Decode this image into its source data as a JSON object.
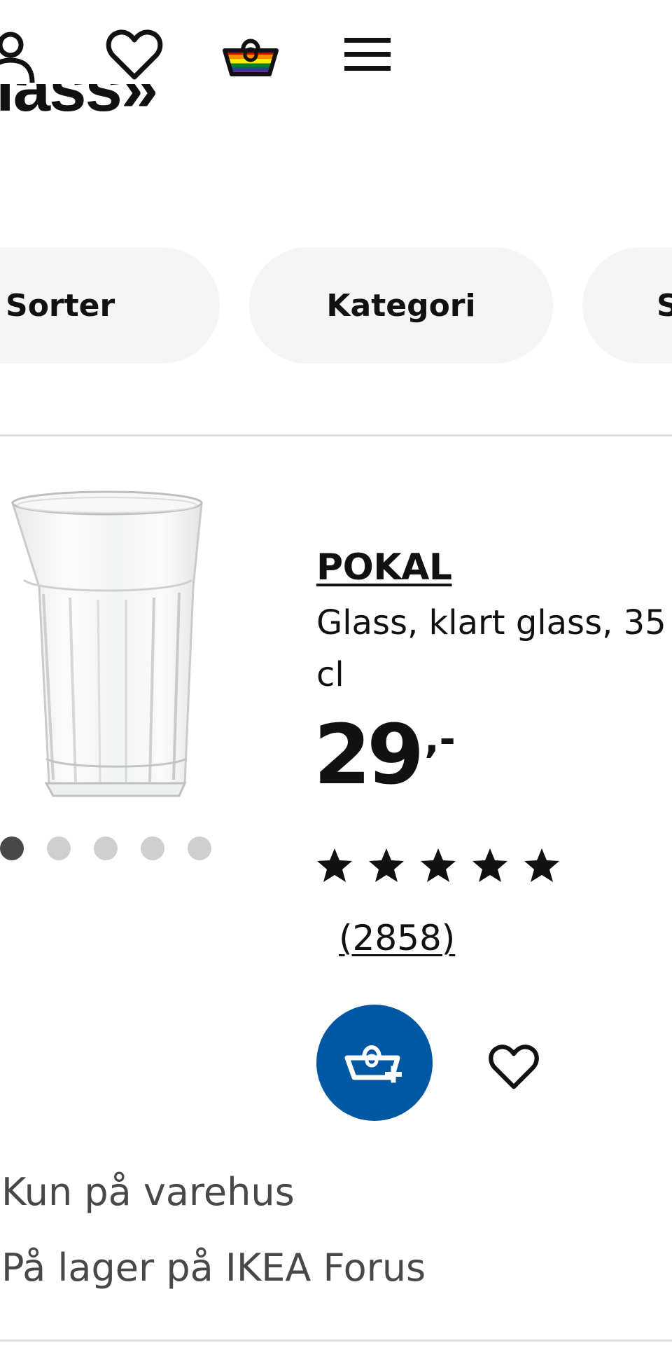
{
  "header": {
    "icons": [
      "profile-icon",
      "heart-icon",
      "shopping-bag-icon",
      "menu-icon"
    ],
    "partial_title": "lass»"
  },
  "filters": {
    "sort_label": "Sorter",
    "category_label": "Kategori",
    "next_label": "S"
  },
  "product": {
    "name": "POKAL",
    "description": "Glass, klart glass, 35 cl",
    "price": "29",
    "price_suffix": ",-",
    "rating_stars": 5,
    "review_count": "(2858)",
    "image_count": 5,
    "active_image_index": 0,
    "availability_1": "Kun på varehus",
    "availability_2": "På lager på IKEA Forus"
  },
  "colors": {
    "accent_blue": "#0058a3",
    "pill_bg": "#f5f5f5",
    "text": "#111111",
    "muted_text": "#484848",
    "divider": "#dfdfdf"
  }
}
